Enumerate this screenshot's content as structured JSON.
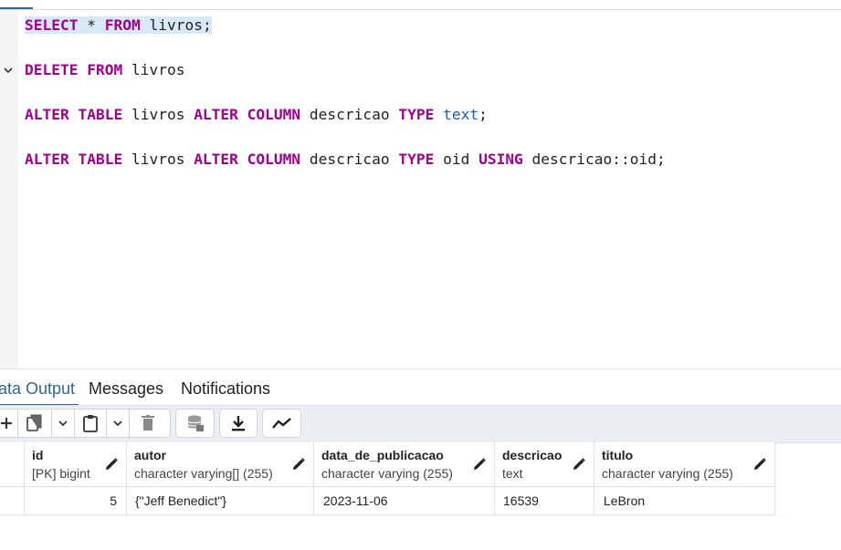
{
  "editor": {
    "lines": [
      {
        "tokens": [
          {
            "t": "SELECT",
            "c": "kw"
          },
          {
            "t": " * ",
            "c": ""
          },
          {
            "t": "FROM",
            "c": "kw"
          },
          {
            "t": " livros;",
            "c": ""
          }
        ],
        "selected": true
      },
      {
        "tokens": [
          {
            "t": "DELETE",
            "c": "kw"
          },
          {
            "t": " ",
            "c": ""
          },
          {
            "t": "FROM",
            "c": "kw"
          },
          {
            "t": " livros",
            "c": ""
          }
        ],
        "selected": false
      },
      {
        "tokens": [
          {
            "t": "ALTER",
            "c": "kw"
          },
          {
            "t": " ",
            "c": ""
          },
          {
            "t": "TABLE",
            "c": "kw"
          },
          {
            "t": " livros ",
            "c": ""
          },
          {
            "t": "ALTER",
            "c": "kw"
          },
          {
            "t": " ",
            "c": ""
          },
          {
            "t": "COLUMN",
            "c": "kw"
          },
          {
            "t": " descricao ",
            "c": ""
          },
          {
            "t": "TYPE",
            "c": "kw"
          },
          {
            "t": " ",
            "c": ""
          },
          {
            "t": "text",
            "c": "ty"
          },
          {
            "t": ";",
            "c": ""
          }
        ],
        "selected": false
      },
      {
        "tokens": [
          {
            "t": "ALTER",
            "c": "kw"
          },
          {
            "t": " ",
            "c": ""
          },
          {
            "t": "TABLE",
            "c": "kw"
          },
          {
            "t": " livros ",
            "c": ""
          },
          {
            "t": "ALTER",
            "c": "kw"
          },
          {
            "t": " ",
            "c": ""
          },
          {
            "t": "COLUMN",
            "c": "kw"
          },
          {
            "t": " descricao ",
            "c": ""
          },
          {
            "t": "TYPE",
            "c": "kw"
          },
          {
            "t": " oid ",
            "c": ""
          },
          {
            "t": "USING",
            "c": "kw"
          },
          {
            "t": " descricao::oid;",
            "c": ""
          }
        ],
        "selected": false
      }
    ],
    "fold_icon": "chevron-down-icon"
  },
  "result_tabs": {
    "data_output": "ata Output",
    "messages": "Messages",
    "notifications": "Notifications"
  },
  "toolbar": {
    "icons": [
      "add-row-icon",
      "copy-icon",
      "copy-dropdown-icon",
      "paste-icon",
      "paste-dropdown-icon",
      "delete-icon",
      "save-data-icon",
      "download-icon",
      "graph-icon"
    ]
  },
  "grid": {
    "columns": [
      {
        "name": "id",
        "type": "[PK] bigint"
      },
      {
        "name": "autor",
        "type": "character varying[] (255)"
      },
      {
        "name": "data_de_publicacao",
        "type": "character varying (255)"
      },
      {
        "name": "descricao",
        "type": "text"
      },
      {
        "name": "titulo",
        "type": "character varying (255)"
      }
    ],
    "rows": [
      [
        "5",
        "{\"Jeff Benedict\"}",
        "2023-11-06",
        "16539",
        "LeBron"
      ]
    ]
  },
  "colors": {
    "keyword": "#a0008c",
    "type": "#1f5f9e",
    "accent": "#326690",
    "selection": "#d7e8f7"
  }
}
